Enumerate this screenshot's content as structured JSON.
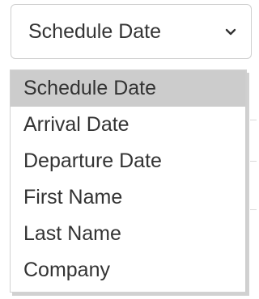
{
  "select": {
    "current_value": "Schedule Date",
    "chevron_icon": "chevron-down-icon"
  },
  "dropdown": {
    "options": [
      {
        "label": "Schedule Date",
        "selected": true
      },
      {
        "label": "Arrival Date",
        "selected": false
      },
      {
        "label": "Departure Date",
        "selected": false
      },
      {
        "label": "First Name",
        "selected": false
      },
      {
        "label": "Last Name",
        "selected": false
      },
      {
        "label": "Company",
        "selected": false
      }
    ],
    "highlight_color": "#cccccc"
  }
}
